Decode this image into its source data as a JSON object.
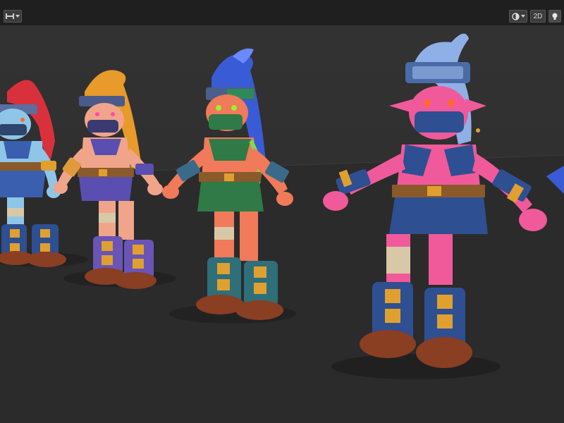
{
  "toolbar": {
    "left_icon": "tool-handle-icon",
    "shading_icon": "shading-mode-icon",
    "dropdown_icon": "chevron-down-icon",
    "toggle_2d_label": "2D",
    "light_icon": "light-bulb-icon"
  },
  "viewport": {
    "background_color": "#2f2f2f",
    "floor_color": "#2b2b2b",
    "characters": [
      {
        "name": "character-red-hair",
        "hair": "#d9313c",
        "skin": "#8fc6e8",
        "outfit": "#3a5fae"
      },
      {
        "name": "character-orange-hair",
        "hair": "#e89a2a",
        "skin": "#f0a58a",
        "outfit": "#5a4fb0"
      },
      {
        "name": "character-blue-hair",
        "hair": "#3a5bd6",
        "skin": "#f07a5a",
        "outfit": "#2f7a46"
      },
      {
        "name": "character-silver-hair",
        "hair": "#8fb0e6",
        "skin": "#f05a9a",
        "outfit": "#2e4f92"
      }
    ]
  }
}
